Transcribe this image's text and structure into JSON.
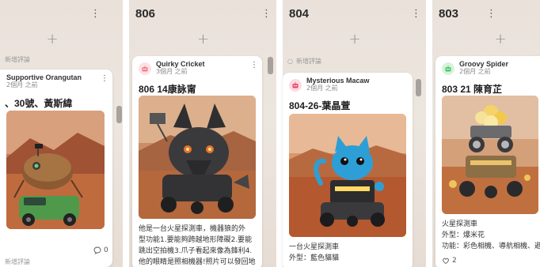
{
  "columns": [
    {
      "title": "",
      "add_label": "+",
      "top_hint": "新增評論",
      "card": {
        "author": "Supportive Orangutan",
        "time": "2個月 之前",
        "title": "、30號、黃斯緯",
        "comments_count": "0",
        "bottom_hint": "新增評論"
      }
    },
    {
      "title": "806",
      "add_label": "+",
      "card": {
        "author": "Quirky Cricket",
        "time": "3個月 之前",
        "title": "806 14康詠甯",
        "avatar_color": "#f27c8a",
        "body_lines": [
          "他是一台火星探測車，機器狼的外",
          "型功能1.要能夠跨越地形障礙2.要能",
          "跳出空拍機3.爪子看起來像為鋒利4.",
          "他的眼睛是照相機器!照片可以發回地"
        ]
      }
    },
    {
      "title": "804",
      "add_label": "+",
      "top_hint": "新增評論",
      "card": {
        "author": "Mysterious Macaw",
        "time": "2個月 之前",
        "title": "804-26-葉晶萱",
        "avatar_color": "#e84a6a",
        "body_lines": [
          "一台火星探測車",
          "外型：藍色貓貓"
        ]
      }
    },
    {
      "title": "803",
      "add_label": "+",
      "card": {
        "author": "Groovy Spider",
        "time": "2個月 之前",
        "title": "803 21 陳育芷",
        "avatar_color": "#4cc46a",
        "body_lines": [
          "火星探測車",
          "外型：爆米花",
          "功能：彩色相機、導航相機、避險相"
        ],
        "likes_count": "2"
      }
    }
  ],
  "colors": {
    "background": "#ebe3dc",
    "card": "#ffffff",
    "mars_sky": "#d9976a",
    "mars_ground": "#b4582f"
  }
}
